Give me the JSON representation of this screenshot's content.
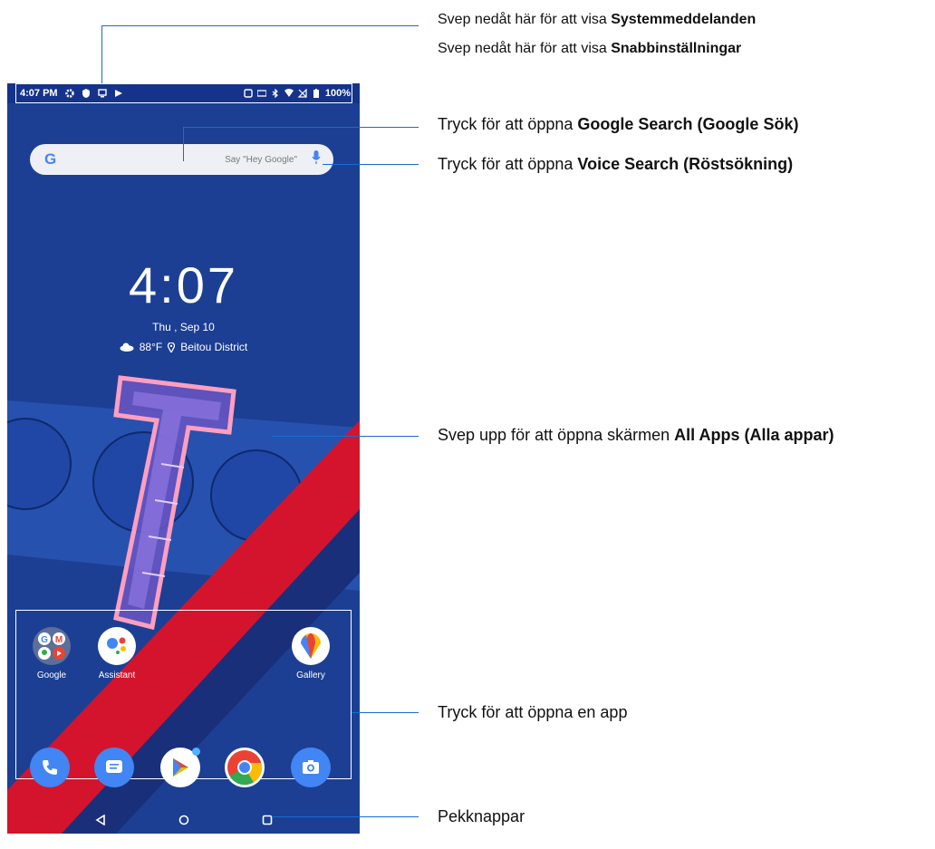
{
  "status_bar": {
    "time": "4:07 PM",
    "battery": "100%",
    "left_icons": [
      "gear-icon",
      "shield-icon",
      "screen-icon",
      "play-icon"
    ],
    "right_icons": [
      "nfc-icon",
      "data-icon",
      "bluetooth-icon",
      "wifi-icon",
      "no-sim-icon",
      "battery-icon"
    ]
  },
  "search": {
    "logo": "G",
    "placeholder": "Say \"Hey Google\""
  },
  "clock": {
    "time": "4:07",
    "date": "Thu , Sep 10",
    "temperature": "88°F",
    "location": "Beitou District"
  },
  "apps": [
    {
      "label": "Google",
      "icon": "google-folder-icon"
    },
    {
      "label": "Assistant",
      "icon": "assistant-icon"
    },
    {
      "label": "Gallery",
      "icon": "gallery-icon"
    }
  ],
  "dock": [
    "phone-icon",
    "messages-icon",
    "play-store-icon",
    "chrome-icon",
    "camera-icon"
  ],
  "nav": [
    "back-icon",
    "home-icon",
    "recents-icon"
  ],
  "callouts": {
    "notifications_prefix": "Svep nedåt här för att visa ",
    "notifications_bold": "Systemmeddelanden",
    "quick_prefix": "Svep nedåt här för att visa ",
    "quick_bold": "Snabbinställningar",
    "google_prefix": "Tryck för att öppna ",
    "google_bold": "Google Search (Google Sök)",
    "voice_prefix": "Tryck för att öppna ",
    "voice_bold": "Voice Search (Röstsökning)",
    "allapps_prefix": "Svep upp för att öppna skärmen ",
    "allapps_bold": "All Apps (Alla appar)",
    "open_app": "Tryck för att öppna en app",
    "nav_keys": "Pekknappar"
  },
  "colors": {
    "wallpaper": "#1c3f93",
    "stripe": "#d4142c",
    "callout_line": "#1a6bd1"
  }
}
